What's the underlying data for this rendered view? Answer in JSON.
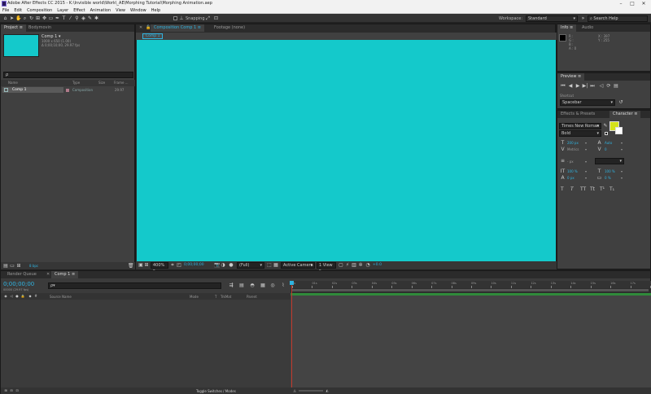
{
  "window": {
    "title": "Adobe After Effects CC 2015 - K:\\Invisible world\\Work\\_AE\\Morphing Tutorial\\Morphing Animation.aep",
    "minimize": "–",
    "maximize": "□",
    "close": "✕"
  },
  "menu": [
    "File",
    "Edit",
    "Composition",
    "Layer",
    "Effect",
    "Animation",
    "View",
    "Window",
    "Help"
  ],
  "toolbar": {
    "snapping_label": "Snapping",
    "workspace_label": "Workspace:",
    "workspace_value": "Standard",
    "search_placeholder": "Search Help"
  },
  "project": {
    "tabs": [
      "Project ≡",
      "Bodymovin"
    ],
    "comp_name": "Comp 1 ▾",
    "comp_size": "1000 x 650 (1.00)",
    "comp_duration": "Δ 0;00;10;00, 29.97 fps",
    "search_placeholder": "ρ",
    "columns": [
      "Name",
      "Type",
      "Size",
      "Frame ..."
    ],
    "items": [
      {
        "name": "Comp 1",
        "type": "Composition",
        "fps": "29.97"
      }
    ],
    "footer_bpc": "8 bpc",
    "thumb_color": "#14c9cb"
  },
  "composition": {
    "tabs": [
      "Composition Comp 1 ≡",
      "Footage (none)"
    ],
    "comp_tab": "Comp 1",
    "canvas_color": "#14c9cb",
    "zoom": "400%",
    "timecode": "0;00;00;00",
    "resolution": "(Full)",
    "camera": "Active Camera",
    "views": "1 View",
    "exposure": "+0.0"
  },
  "info": {
    "tabs": [
      "Info ≡",
      "Audio"
    ],
    "r": "R :",
    "g": "G :",
    "b": "B :",
    "a": "A : 0",
    "x": "X : 397",
    "y": "Y : 255"
  },
  "preview": {
    "title": "Preview ≡",
    "shortcut_label": "Shortcut",
    "shortcut_value": "Spacebar"
  },
  "character": {
    "tabs": [
      "Effects & Presets",
      "Character ≡"
    ],
    "font": "Times New Roman",
    "style": "Bold",
    "font_size": "200 px",
    "leading": "Auto",
    "kerning": "Metrics",
    "tracking": "0",
    "stroke_width": "- px",
    "vscale": "100 %",
    "hscale": "100 %",
    "baseline": "0 px",
    "tsume": "0 %",
    "fill_color": "#d5e21b",
    "styles": [
      "T",
      "T",
      "TT",
      "Tt",
      "T¹",
      "T₁"
    ]
  },
  "timeline": {
    "tabs": [
      "Render Queue",
      "Comp 1 ≡"
    ],
    "timecode": "0;00;00;00",
    "frame_info": "00000 (29.97 fps)",
    "search_placeholder": "ρ▾",
    "columns": [
      "Source Name",
      "Mode",
      "T",
      "TrkMat",
      "Parent"
    ],
    "ruler": [
      "0s",
      "01s",
      "02s",
      "03s",
      "04s",
      "05s",
      "06s",
      "07s",
      "08s",
      "09s",
      "10s",
      "11s",
      "12s",
      "13s",
      "14s",
      "15s",
      "16s",
      "17s",
      "18s"
    ],
    "toggle_label": "Toggle Switches / Modes"
  },
  "colors": {
    "accent": "#2fb3e0",
    "teal": "#14c9cb",
    "bar_green": "#2f8a3a",
    "playhead": "#c0392b"
  }
}
